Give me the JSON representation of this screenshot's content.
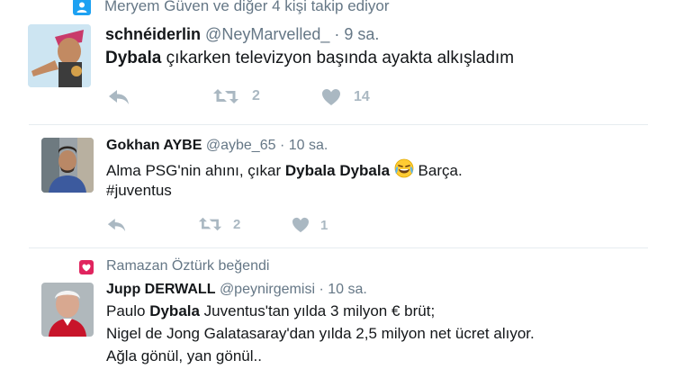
{
  "tweet1": {
    "context": "Meryem Güven ve diğer 4 kişi takip ediyor",
    "context_icon": "follow-person-icon",
    "name": "schnéiderlin",
    "handle": "@NeyMarvelled_",
    "dot": "·",
    "time": "9 sa.",
    "text_bold": "Dybala",
    "text_rest": " çıkarken televizyon başında ayakta alkışladım",
    "retweets": "2",
    "likes": "14"
  },
  "tweet2": {
    "name": "Gokhan AYBE",
    "handle": "@aybe_65",
    "dot": "·",
    "time": "10 sa.",
    "line1_a": "Alma PSG'nin ahını, çıkar ",
    "line1_bold": "Dybala Dybala",
    "line1_emoji": "face-with-tears-of-joy",
    "line1_b": " Barça.",
    "line2": "#juventus",
    "retweets": "2",
    "likes": "1"
  },
  "tweet3": {
    "context": "Ramazan Öztürk beğendi",
    "context_icon": "liked-heart-icon",
    "name": "Jupp DERWALL",
    "handle": "@peynirgemisi",
    "dot": "·",
    "time": "10 sa.",
    "line1_a": "Paulo ",
    "line1_bold": "Dybala",
    "line1_b": " Juventus'tan yılda 3 milyon € brüt;",
    "line2": "Nigel de Jong Galatasaray'dan yılda 2,5 milyon net ücret alıyor.",
    "line3": "Ağla gönül, yan gönül.."
  },
  "colors": {
    "accent": "#1da1f2",
    "like_red": "#e0245e",
    "secondary": "#657786",
    "action_gray": "#aab8c2"
  }
}
